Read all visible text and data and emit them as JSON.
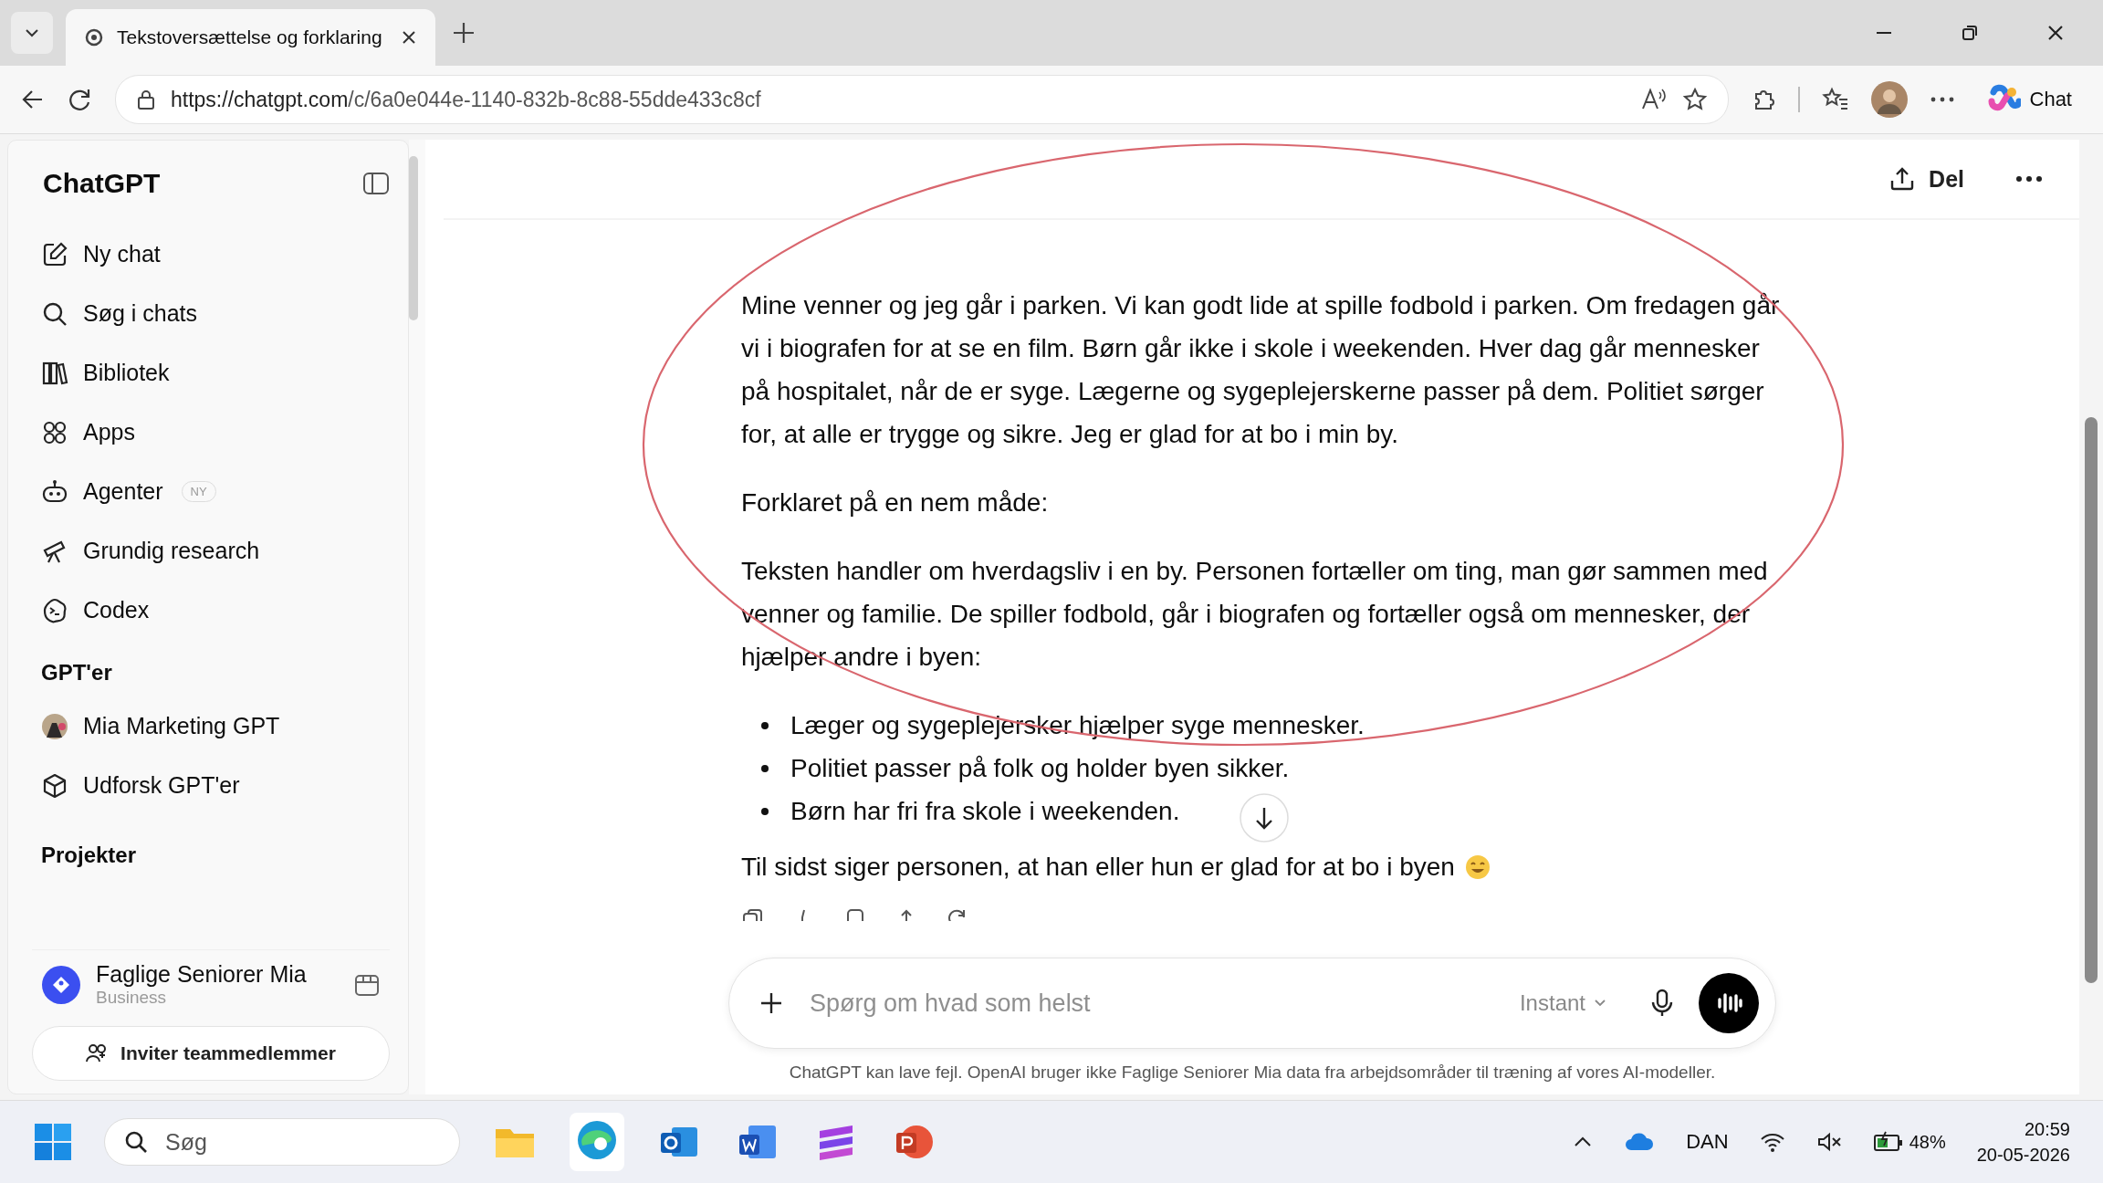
{
  "browser": {
    "tabs": [
      {
        "title": "Tekstoversættelse og forklaring",
        "selected": true
      }
    ],
    "url_host": "https://chatgpt.com",
    "url_path": "/c/6a0e044e-1140-832b-8c88-55dde433c8cf",
    "copilot_label": "Chat"
  },
  "sidebar": {
    "title": "ChatGPT",
    "nav": [
      {
        "label": "Ny chat"
      },
      {
        "label": "Søg i chats"
      },
      {
        "label": "Bibliotek"
      },
      {
        "label": "Apps"
      },
      {
        "label": "Agenter",
        "badge": "NY"
      },
      {
        "label": "Grundig research"
      },
      {
        "label": "Codex"
      }
    ],
    "gpts_heading": "GPT'er",
    "gpts": [
      {
        "label": "Mia Marketing GPT"
      },
      {
        "label": "Udforsk GPT'er"
      }
    ],
    "projects_heading": "Projekter",
    "workspace": {
      "name": "Faglige Seniorer Mia",
      "plan": "Business"
    },
    "invite_button": "Inviter teammedlemmer"
  },
  "header": {
    "share_button": "Del"
  },
  "message": [
    {
      "kind": "paragraph",
      "text": "Mine venner og jeg går i parken. Vi kan godt lide at spille fodbold i parken. Om fredagen går vi i biografen for at se en film. Børn går ikke i skole i weekenden. Hver dag går mennesker på hospitalet, når de er syge. Lægerne og sygeplejerskerne passer på dem. Politiet sørger for, at alle er trygge og sikre. Jeg er glad for at bo i min by."
    },
    {
      "kind": "paragraph",
      "text": "Forklaret på en nem måde:"
    },
    {
      "kind": "paragraph",
      "text": "Teksten handler om hverdagsliv i en by. Personen fortæller om ting, man gør sammen med venner og familie. De spiller fodbold, går i biografen og fortæller også om mennesker, der hjælper andre i byen:"
    },
    {
      "kind": "bullets",
      "items": [
        "Læger og sygeplejersker hjælper syge mennesker.",
        "Politiet passer på folk og holder byen sikker.",
        "Børn har fri fra skole i weekenden."
      ]
    },
    {
      "kind": "paragraph",
      "text": "Til sidst siger personen, at han eller hun er glad for at bo i byen",
      "trailing_emoji": true
    }
  ],
  "composer": {
    "placeholder": "Spørg om hvad som helst",
    "model": "Instant"
  },
  "disclaimer": "ChatGPT kan lave fejl. OpenAI bruger ikke Faglige Seniorer Mia data fra arbejdsområder til træning af vores AI-modeller.",
  "taskbar": {
    "search_placeholder": "Søg",
    "language": "DAN",
    "battery": "48%",
    "time": "20:59",
    "date": "20-05-2026"
  }
}
